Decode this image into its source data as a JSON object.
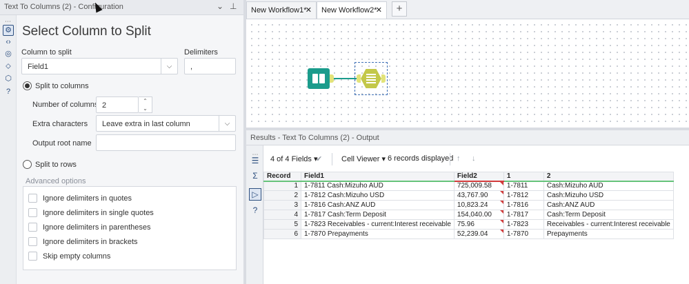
{
  "config_panel": {
    "title": "Text To Columns (2) - Configuration",
    "heading": "Select Column to Split",
    "column_to_split_label": "Column to split",
    "column_to_split_value": "Field1",
    "delimiters_label": "Delimiters",
    "delimiters_value": ",",
    "split_to_columns_label": "Split to columns",
    "number_of_columns_label": "Number of columns",
    "number_of_columns_value": "2",
    "extra_characters_label": "Extra characters",
    "extra_characters_value": "Leave extra in last column",
    "output_root_name_label": "Output root name",
    "output_root_name_value": "",
    "split_to_rows_label": "Split to rows",
    "advanced_label": "Advanced options",
    "advanced_options": [
      "Ignore delimiters in quotes",
      "Ignore delimiters in single quotes",
      "Ignore delimiters in parentheses",
      "Ignore delimiters in brackets",
      "Skip empty columns"
    ],
    "selected_mode": "split-to-columns"
  },
  "tabs": [
    {
      "label": "New Workflow1*",
      "active": false
    },
    {
      "label": "New Workflow2*",
      "active": true
    }
  ],
  "results": {
    "title": "Results - Text To Columns (2) - Output",
    "fields_label": "4 of 4 Fields",
    "viewer_label": "Cell Viewer",
    "records_label": "6 records displayed",
    "columns": [
      "Record",
      "Field1",
      "Field2",
      "1",
      "2"
    ],
    "rows": [
      [
        "1",
        "1-7811 Cash:Mizuho AUD",
        "725,009.58",
        "1-7811",
        "Cash:Mizuho AUD"
      ],
      [
        "2",
        "1-7812 Cash:Mizuho USD",
        "43,767.90",
        "1-7812",
        "Cash:Mizuho USD"
      ],
      [
        "3",
        "1-7816 Cash:ANZ AUD",
        "10,823.24",
        "1-7816",
        "Cash:ANZ AUD"
      ],
      [
        "4",
        "1-7817 Cash:Term Deposit",
        "154,040.00",
        "1-7817",
        "Cash:Term Deposit"
      ],
      [
        "5",
        "1-7823 Receivables - current:Interest receivable",
        "75.96",
        "1-7823",
        "Receivables - current:Interest receivable"
      ],
      [
        "6",
        "1-7870 Prepayments",
        "52,239.04",
        "1-7870",
        "Prepayments"
      ]
    ]
  },
  "colors": {
    "input_tool": "#1b9c8c",
    "text_to_columns_tool": "#c3c84a",
    "accent_blue": "#2d4f7f",
    "flag_red": "#d23b3b"
  }
}
